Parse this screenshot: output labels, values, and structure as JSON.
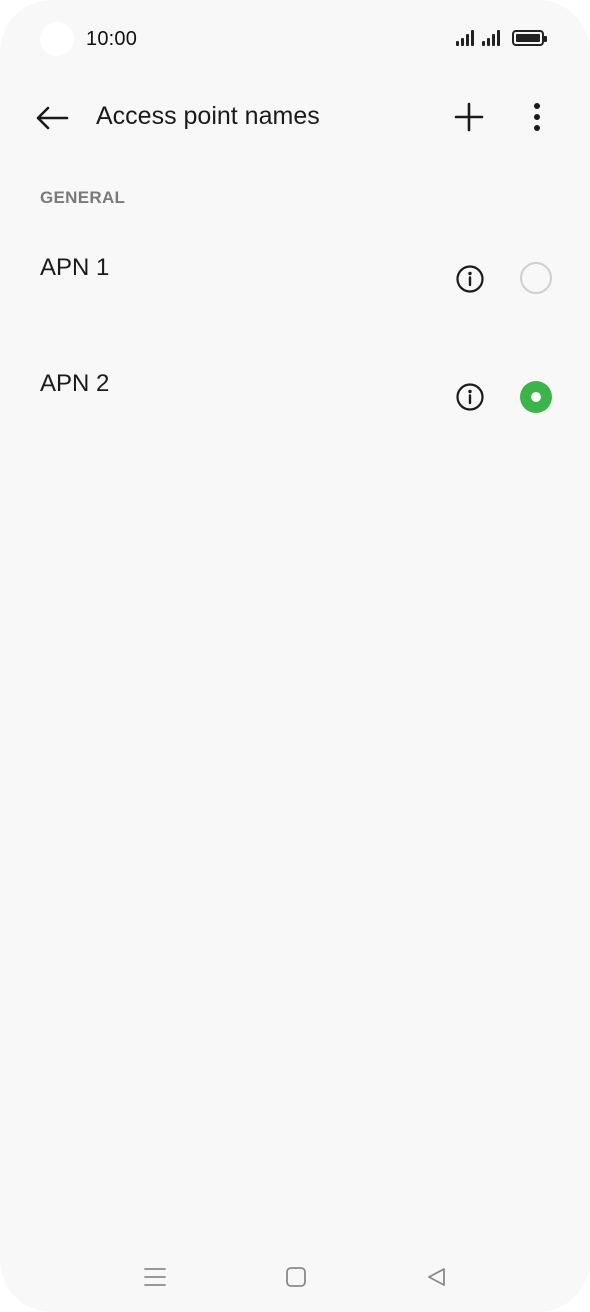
{
  "status_bar": {
    "time": "10:00",
    "icons": [
      "signal-icon",
      "signal-icon",
      "battery-icon"
    ]
  },
  "toolbar": {
    "title": "Access point names",
    "back_icon": "arrow-left-icon",
    "add_icon": "plus-icon",
    "more_icon": "more-vertical-icon"
  },
  "section": {
    "header": "GENERAL"
  },
  "apn_list": [
    {
      "name": "APN 1",
      "selected": false,
      "info_icon": "info-icon"
    },
    {
      "name": "APN 2",
      "selected": true,
      "info_icon": "info-icon"
    }
  ],
  "nav_bar": {
    "icons": [
      "menu-icon",
      "home-square-icon",
      "back-triangle-icon"
    ]
  },
  "colors": {
    "background": "#f8f8f8",
    "accent": "#3bb54a",
    "text": "#1a1a1a",
    "section_header": "#7a7a7a",
    "radio_off_border": "#cfcfcf"
  }
}
